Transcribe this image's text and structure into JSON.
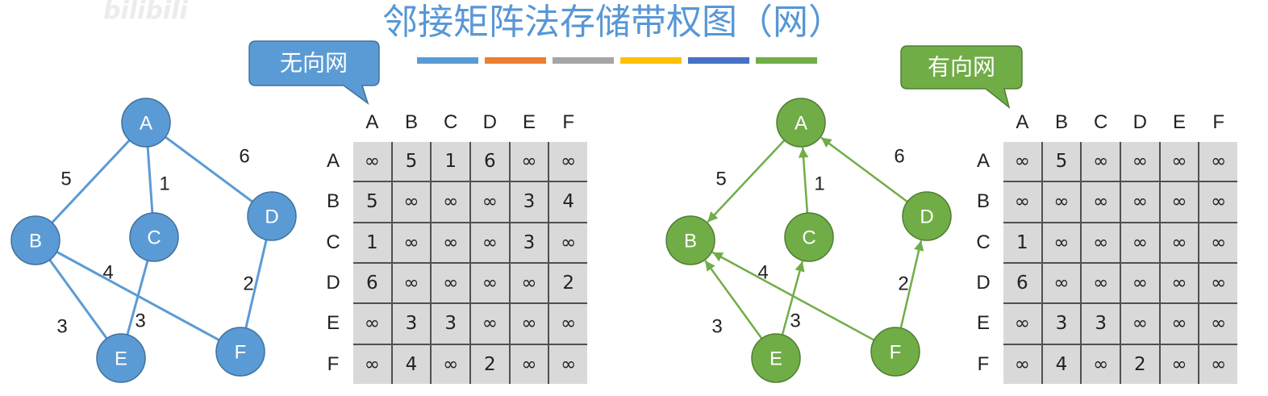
{
  "watermark": "bilibili",
  "title": "邻接矩阵法存储带权图（网）",
  "title_color": "#5797d6",
  "color_bars": [
    "#5b9bd5",
    "#ed7d31",
    "#a5a5a5",
    "#ffc000",
    "#4472c4",
    "#70ad47"
  ],
  "undirected": {
    "callout": "无向网",
    "color": "#5b9bd5",
    "node_stroke": "#41719c",
    "nodes": [
      "A",
      "B",
      "C",
      "D",
      "E",
      "F"
    ],
    "edges": [
      {
        "from": 0,
        "to": 1,
        "weight": "5"
      },
      {
        "from": 0,
        "to": 2,
        "weight": "1"
      },
      {
        "from": 0,
        "to": 3,
        "weight": "6"
      },
      {
        "from": 1,
        "to": 4,
        "weight": "3"
      },
      {
        "from": 1,
        "to": 5,
        "weight": "4"
      },
      {
        "from": 2,
        "to": 4,
        "weight": "3"
      },
      {
        "from": 3,
        "to": 5,
        "weight": "2"
      }
    ],
    "matrix": {
      "cols": [
        "A",
        "B",
        "C",
        "D",
        "E",
        "F"
      ],
      "rows": [
        {
          "label": "A",
          "cells": [
            "∞",
            "5",
            "1",
            "6",
            "∞",
            "∞"
          ]
        },
        {
          "label": "B",
          "cells": [
            "5",
            "∞",
            "∞",
            "∞",
            "3",
            "4"
          ]
        },
        {
          "label": "C",
          "cells": [
            "1",
            "∞",
            "∞",
            "∞",
            "3",
            "∞"
          ]
        },
        {
          "label": "D",
          "cells": [
            "6",
            "∞",
            "∞",
            "∞",
            "∞",
            "2"
          ]
        },
        {
          "label": "E",
          "cells": [
            "∞",
            "3",
            "3",
            "∞",
            "∞",
            "∞"
          ]
        },
        {
          "label": "F",
          "cells": [
            "∞",
            "4",
            "∞",
            "2",
            "∞",
            "∞"
          ]
        }
      ]
    }
  },
  "directed": {
    "callout": "有向网",
    "color": "#70ad47",
    "node_stroke": "#507e32",
    "nodes": [
      "A",
      "B",
      "C",
      "D",
      "E",
      "F"
    ],
    "edges": [
      {
        "from": 0,
        "to": 1,
        "weight": "5"
      },
      {
        "from": 2,
        "to": 0,
        "weight": "1"
      },
      {
        "from": 3,
        "to": 0,
        "weight": "6"
      },
      {
        "from": 4,
        "to": 1,
        "weight": "3"
      },
      {
        "from": 5,
        "to": 1,
        "weight": "4"
      },
      {
        "from": 4,
        "to": 2,
        "weight": "3"
      },
      {
        "from": 5,
        "to": 3,
        "weight": "2"
      }
    ],
    "matrix": {
      "cols": [
        "A",
        "B",
        "C",
        "D",
        "E",
        "F"
      ],
      "rows": [
        {
          "label": "A",
          "cells": [
            "∞",
            "5",
            "∞",
            "∞",
            "∞",
            "∞"
          ]
        },
        {
          "label": "B",
          "cells": [
            "∞",
            "∞",
            "∞",
            "∞",
            "∞",
            "∞"
          ]
        },
        {
          "label": "C",
          "cells": [
            "1",
            "∞",
            "∞",
            "∞",
            "∞",
            "∞"
          ]
        },
        {
          "label": "D",
          "cells": [
            "6",
            "∞",
            "∞",
            "∞",
            "∞",
            "∞"
          ]
        },
        {
          "label": "E",
          "cells": [
            "∞",
            "3",
            "3",
            "∞",
            "∞",
            "∞"
          ]
        },
        {
          "label": "F",
          "cells": [
            "∞",
            "4",
            "∞",
            "2",
            "∞",
            "∞"
          ]
        }
      ]
    }
  }
}
